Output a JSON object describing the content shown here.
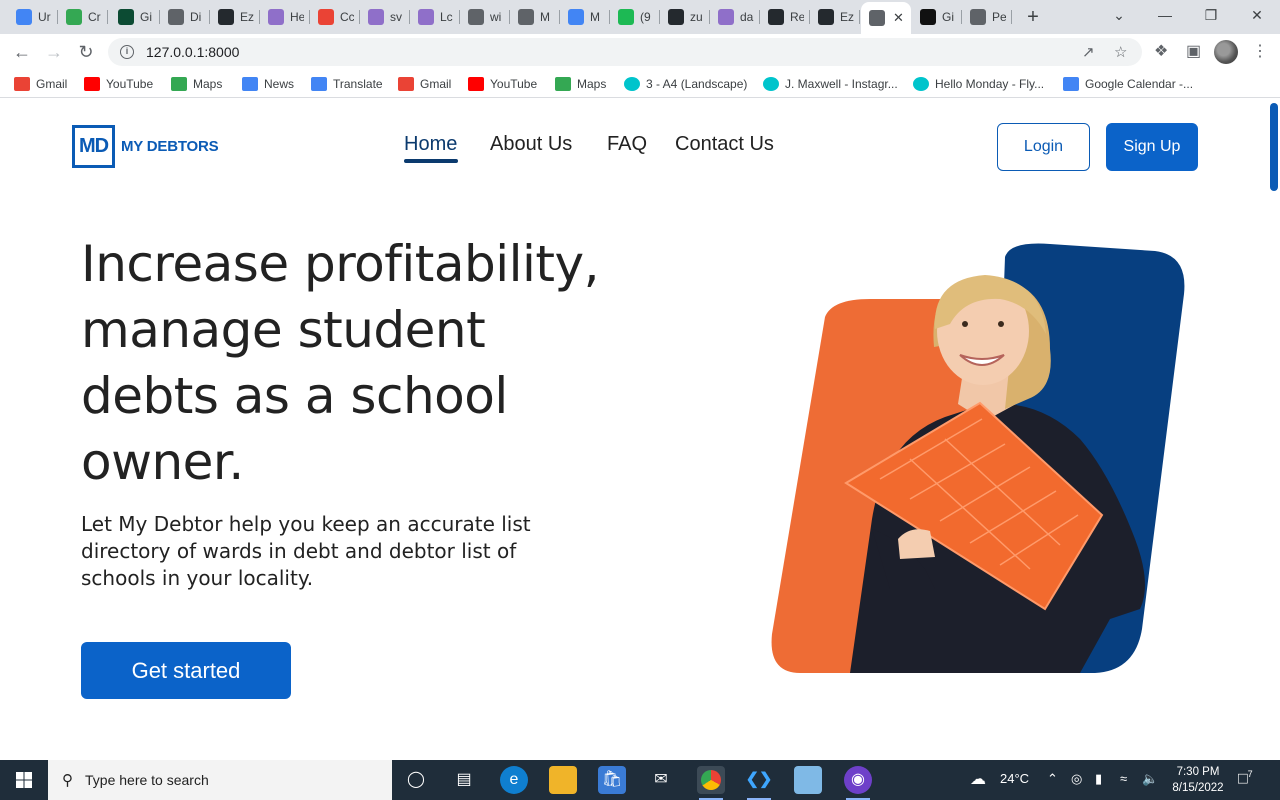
{
  "browser": {
    "tabs": [
      {
        "label": "Ur",
        "icon": "docs-icon",
        "color": "#4285f4"
      },
      {
        "label": "Cr",
        "icon": "page-icon",
        "color": "#34a853"
      },
      {
        "label": "Gi",
        "icon": "django-icon",
        "color": "#0c4b33"
      },
      {
        "label": "Di",
        "icon": "globe-icon",
        "color": "#5f6368"
      },
      {
        "label": "Ez",
        "icon": "github-icon",
        "color": "#24292e"
      },
      {
        "label": "He",
        "icon": "h-icon",
        "color": "#8f6fc9"
      },
      {
        "label": "Cc",
        "icon": "gmail-icon",
        "color": "#ea4335"
      },
      {
        "label": "sv",
        "icon": "h-icon",
        "color": "#8f6fc9"
      },
      {
        "label": "Lc",
        "icon": "h-icon",
        "color": "#8f6fc9"
      },
      {
        "label": "wi",
        "icon": "globe-icon",
        "color": "#5f6368"
      },
      {
        "label": "M",
        "icon": "globe-icon",
        "color": "#5f6368"
      },
      {
        "label": "M",
        "icon": "docs-icon",
        "color": "#4285f4"
      },
      {
        "label": "(9",
        "icon": "badge-94-icon",
        "color": "#1db954"
      },
      {
        "label": "zu",
        "icon": "github-icon",
        "color": "#24292e"
      },
      {
        "label": "da",
        "icon": "h-icon",
        "color": "#8f6fc9"
      },
      {
        "label": "Re",
        "icon": "github-icon",
        "color": "#24292e"
      },
      {
        "label": "Ez",
        "icon": "github-icon",
        "color": "#24292e"
      },
      {
        "label": "",
        "icon": "globe-icon",
        "color": "#5f6368",
        "active": true
      },
      {
        "label": "Gi",
        "icon": "dev-icon",
        "color": "#111111"
      },
      {
        "label": "Pe",
        "icon": "globe-icon",
        "color": "#5f6368"
      }
    ],
    "url": "127.0.0.1:8000",
    "bookmarks": [
      {
        "label": "Gmail",
        "icon": "gmail-icon",
        "color": "#ea4335"
      },
      {
        "label": "YouTube",
        "icon": "youtube-icon",
        "color": "#ff0000"
      },
      {
        "label": "Maps",
        "icon": "maps-icon",
        "color": "#34a853"
      },
      {
        "label": "News",
        "icon": "news-icon",
        "color": "#4285f4"
      },
      {
        "label": "Translate",
        "icon": "translate-icon",
        "color": "#4285f4"
      },
      {
        "label": "Gmail",
        "icon": "gmail-icon",
        "color": "#ea4335"
      },
      {
        "label": "YouTube",
        "icon": "youtube-icon",
        "color": "#ff0000"
      },
      {
        "label": "Maps",
        "icon": "maps-icon",
        "color": "#34a853"
      },
      {
        "label": "3 - A4 (Landscape)",
        "icon": "canva-icon",
        "color": "#00c4cc"
      },
      {
        "label": "J. Maxwell - Instagr...",
        "icon": "canva-icon",
        "color": "#00c4cc"
      },
      {
        "label": "Hello Monday - Fly...",
        "icon": "canva-icon",
        "color": "#00c4cc"
      },
      {
        "label": "Google Calendar -...",
        "icon": "calendar-icon",
        "color": "#4285f4"
      }
    ]
  },
  "site": {
    "logo_mark": "MD",
    "logo_text": "MY DEBTORS",
    "nav": {
      "home": "Home",
      "about": "About Us",
      "faq": "FAQ",
      "contact": "Contact Us"
    },
    "login_label": "Login",
    "signup_label": "Sign Up",
    "hero": {
      "title": "Increase profitability, manage student debts as a school owner.",
      "subtitle": "Let My Debtor help you keep an accurate list directory of wards in debt and debtor list of schools in your locality.",
      "cta_label": "Get started"
    },
    "colors": {
      "brand_blue": "#0b63c9",
      "navy": "#073f80",
      "orange": "#ee6c35"
    }
  },
  "taskbar": {
    "search_placeholder": "Type here to search",
    "weather": "24°C",
    "time": "7:30 PM",
    "date": "8/15/2022",
    "notifications": "7"
  }
}
